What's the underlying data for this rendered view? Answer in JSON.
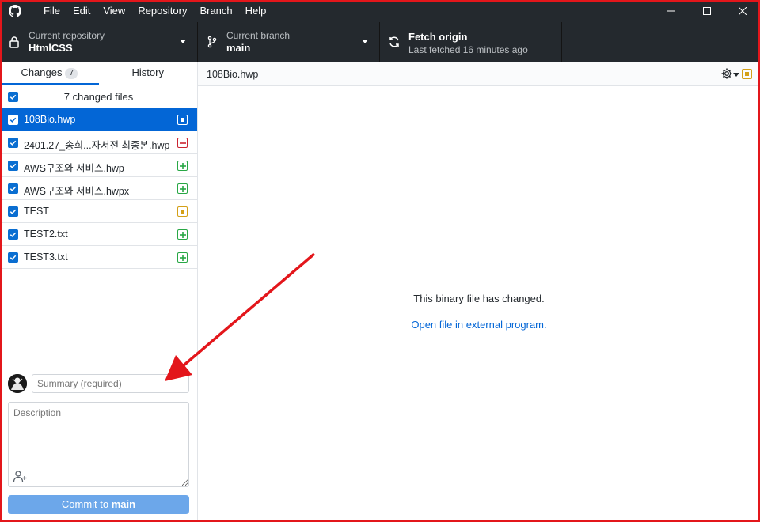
{
  "menu": [
    "File",
    "Edit",
    "View",
    "Repository",
    "Branch",
    "Help"
  ],
  "toolbar": {
    "repo_label": "Current repository",
    "repo_value": "HtmlCSS",
    "branch_label": "Current branch",
    "branch_value": "main",
    "fetch_label": "Fetch origin",
    "fetch_value": "Last fetched 16 minutes ago"
  },
  "tabs": {
    "changes": "Changes",
    "changes_count": "7",
    "history": "History"
  },
  "changes_header": "7 changed files",
  "files": [
    {
      "name": "108Bio.hwp",
      "status": "modified"
    },
    {
      "name": "2401.27_송희...자서전 최종본.hwp",
      "status": "deleted"
    },
    {
      "name": "AWS구조와 서비스.hwp",
      "status": "added"
    },
    {
      "name": "AWS구조와 서비스.hwpx",
      "status": "added"
    },
    {
      "name": "TEST",
      "status": "modified"
    },
    {
      "name": "TEST2.txt",
      "status": "added"
    },
    {
      "name": "TEST3.txt",
      "status": "added"
    }
  ],
  "commit": {
    "summary_placeholder": "Summary (required)",
    "description_placeholder": "Description",
    "button_prefix": "Commit to",
    "button_branch": "main"
  },
  "main": {
    "path": "108Bio.hwp",
    "message": "This binary file has changed.",
    "link": "Open file in external program."
  },
  "colors": {
    "accent": "#0366d6",
    "added": "#28a745",
    "deleted": "#cb2431",
    "modified": "#d4a017",
    "annotation": "#e3161b"
  }
}
